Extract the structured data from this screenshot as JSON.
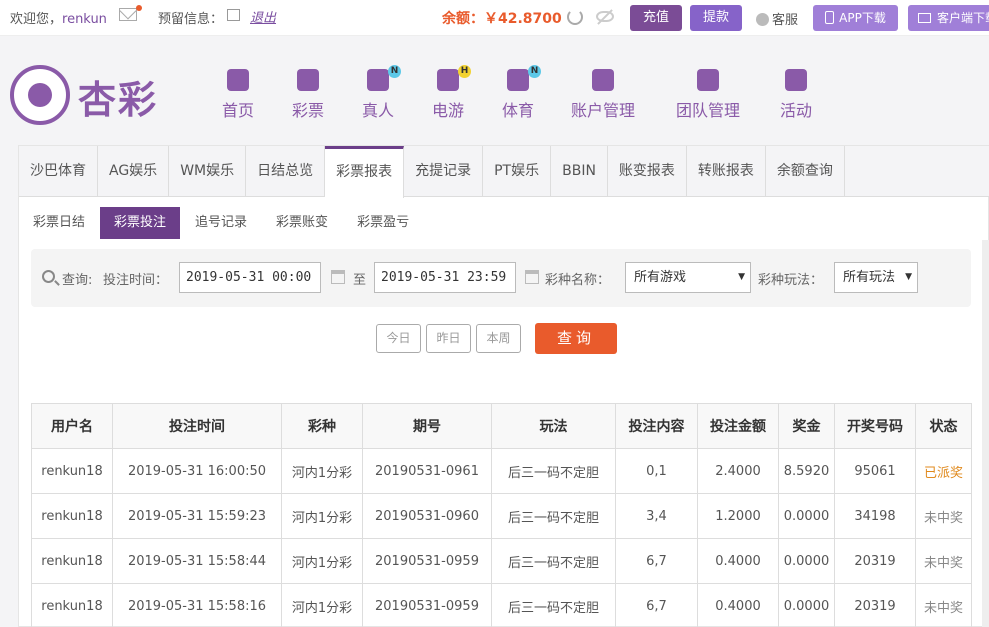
{
  "topbar": {
    "welcome_prefix": "欢迎您，",
    "username": "renkun",
    "reserve_label": "预留信息：",
    "logout_label": "退出",
    "balance_text": "余额：￥42.8700",
    "recharge_label": "充值",
    "withdraw_label": "提款",
    "service_label": "客服",
    "app_download_label": "APP下载",
    "client_download_label": "客户端下载"
  },
  "brand": {
    "logo_text": "杏彩"
  },
  "nav": [
    {
      "label": "首页",
      "icon": "home-icon",
      "badge": ""
    },
    {
      "label": "彩票",
      "icon": "ticket-icon",
      "badge": ""
    },
    {
      "label": "真人",
      "icon": "live-dealer-icon",
      "badge": "N"
    },
    {
      "label": "电游",
      "icon": "gamepad-icon",
      "badge": "H"
    },
    {
      "label": "体育",
      "icon": "trophy-icon",
      "badge": "N"
    },
    {
      "label": "账户管理",
      "icon": "yen-icon",
      "badge": ""
    },
    {
      "label": "团队管理",
      "icon": "team-icon",
      "badge": ""
    },
    {
      "label": "活动",
      "icon": "gift-icon",
      "badge": ""
    }
  ],
  "tabs": [
    "沙巴体育",
    "AG娱乐",
    "WM娱乐",
    "日结总览",
    "彩票报表",
    "充提记录",
    "PT娱乐",
    "BBIN",
    "账变报表",
    "转账报表",
    "余额查询"
  ],
  "active_tab": "彩票报表",
  "subtabs": [
    "彩票日结",
    "彩票投注",
    "追号记录",
    "彩票账变",
    "彩票盈亏"
  ],
  "active_subtab": "彩票投注",
  "filter": {
    "query_label": "查询:",
    "bet_time_label": "投注时间：",
    "start_time": "2019-05-31 00:00:00",
    "to_label": "至",
    "end_time": "2019-05-31 23:59:59",
    "lottery_name_label": "彩种名称：",
    "lottery_name_value": "所有游戏",
    "play_label": "彩种玩法：",
    "play_value": "所有玩法"
  },
  "quick": {
    "today": "今日",
    "yesterday": "昨日",
    "week": "本周",
    "query": "查询"
  },
  "table": {
    "headers": [
      "用户名",
      "投注时间",
      "彩种",
      "期号",
      "玩法",
      "投注内容",
      "投注金额",
      "奖金",
      "开奖号码",
      "状态"
    ],
    "rows": [
      [
        "renkun18",
        "2019-05-31 16:00:50",
        "河内1分彩",
        "20190531-0961",
        "后三一码不定胆",
        "0,1",
        "2.4000",
        "8.5920",
        "95061",
        "已派奖"
      ],
      [
        "renkun18",
        "2019-05-31 15:59:23",
        "河内1分彩",
        "20190531-0960",
        "后三一码不定胆",
        "3,4",
        "1.2000",
        "0.0000",
        "34198",
        "未中奖"
      ],
      [
        "renkun18",
        "2019-05-31 15:58:44",
        "河内1分彩",
        "20190531-0959",
        "后三一码不定胆",
        "6,7",
        "0.4000",
        "0.0000",
        "20319",
        "未中奖"
      ],
      [
        "renkun18",
        "2019-05-31 15:58:16",
        "河内1分彩",
        "20190531-0959",
        "后三一码不定胆",
        "6,7",
        "0.4000",
        "0.0000",
        "20319",
        "未中奖"
      ]
    ]
  },
  "colors": {
    "brand_purple": "#6b3e89",
    "accent_orange": "#e95b2c",
    "won": "#e08a1e"
  }
}
